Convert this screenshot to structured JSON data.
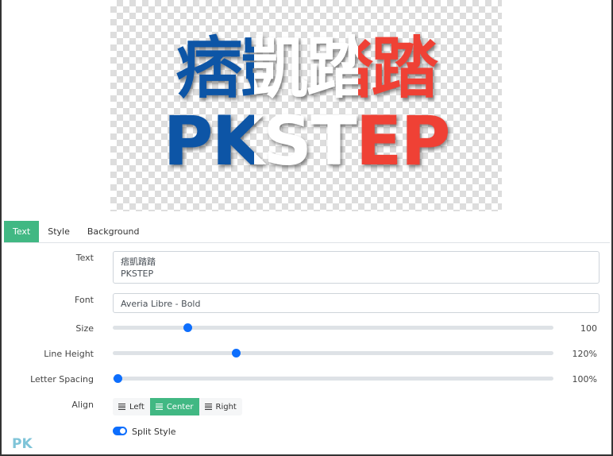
{
  "preview": {
    "line1": "痞凱踏踏",
    "line2": "PKSTEP",
    "colors": [
      "#0d55a6",
      "#ffffff",
      "#ef4135"
    ]
  },
  "tabs": [
    {
      "label": "Text",
      "active": true
    },
    {
      "label": "Style"
    },
    {
      "label": "Background"
    }
  ],
  "form": {
    "text": {
      "label": "Text",
      "value": "痞凱踏踏\nPKSTEP"
    },
    "font": {
      "label": "Font",
      "value": "Averia Libre - Bold"
    },
    "size": {
      "label": "Size",
      "value": "100",
      "fraction": 0.17
    },
    "line_height": {
      "label": "Line Height",
      "value": "120%",
      "fraction": 0.28
    },
    "letter_spacing": {
      "label": "Letter Spacing",
      "value": "100%",
      "fraction": 0.01
    },
    "align": {
      "label": "Align",
      "options": [
        "Left",
        "Center",
        "Right"
      ],
      "selected": "Center"
    },
    "split_style": {
      "label": "Split Style",
      "enabled": true
    }
  },
  "watermark": "PK",
  "accent": "#41b883"
}
